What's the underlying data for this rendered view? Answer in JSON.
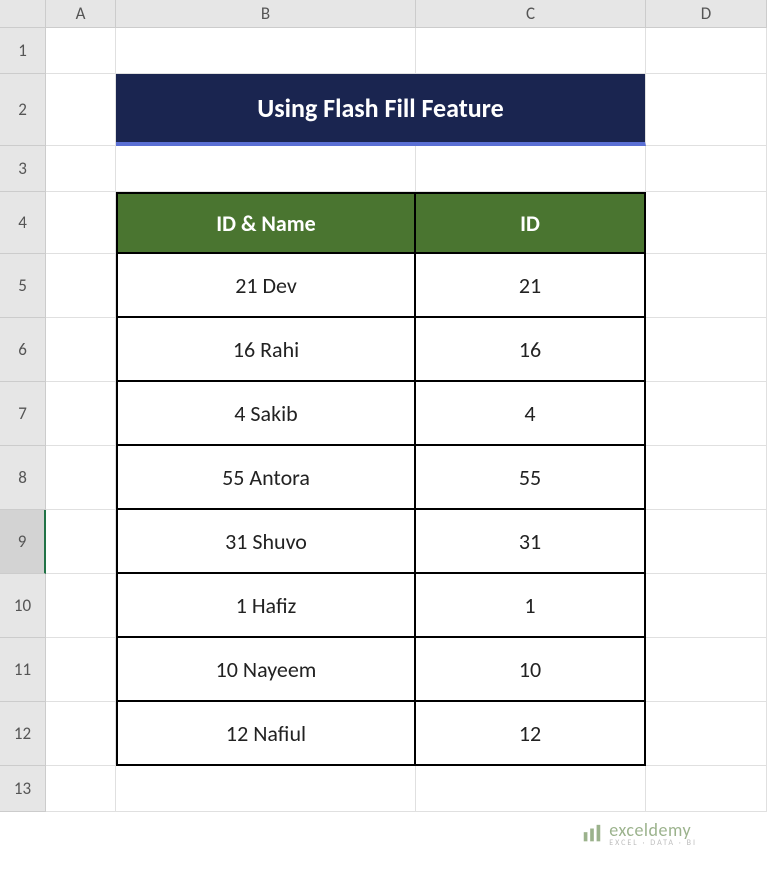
{
  "columns": {
    "A": "A",
    "B": "B",
    "C": "C",
    "D": "D"
  },
  "rows": [
    "1",
    "2",
    "3",
    "4",
    "5",
    "6",
    "7",
    "8",
    "9",
    "10",
    "11",
    "12",
    "13"
  ],
  "selected_row_index": 8,
  "title": "Using Flash Fill Feature",
  "table": {
    "headers": {
      "id_name": "ID & Name",
      "id": "ID"
    },
    "data": [
      {
        "id_name": "21 Dev",
        "id": "21"
      },
      {
        "id_name": "16 Rahi",
        "id": "16"
      },
      {
        "id_name": "4 Sakib",
        "id": "4"
      },
      {
        "id_name": "55 Antora",
        "id": "55"
      },
      {
        "id_name": "31 Shuvo",
        "id": "31"
      },
      {
        "id_name": "1 Hafiz",
        "id": "1"
      },
      {
        "id_name": "10 Nayeem",
        "id": "10"
      },
      {
        "id_name": "12 Nafiul",
        "id": "12"
      }
    ]
  },
  "watermark": {
    "brand": "exceldemy",
    "tag": "EXCEL · DATA · BI"
  },
  "col_widths": {
    "A": 70,
    "B": 300,
    "C": 230,
    "D": 121
  },
  "row_heights": {
    "blank": 46,
    "title": 72,
    "header": 62,
    "data": 64
  }
}
